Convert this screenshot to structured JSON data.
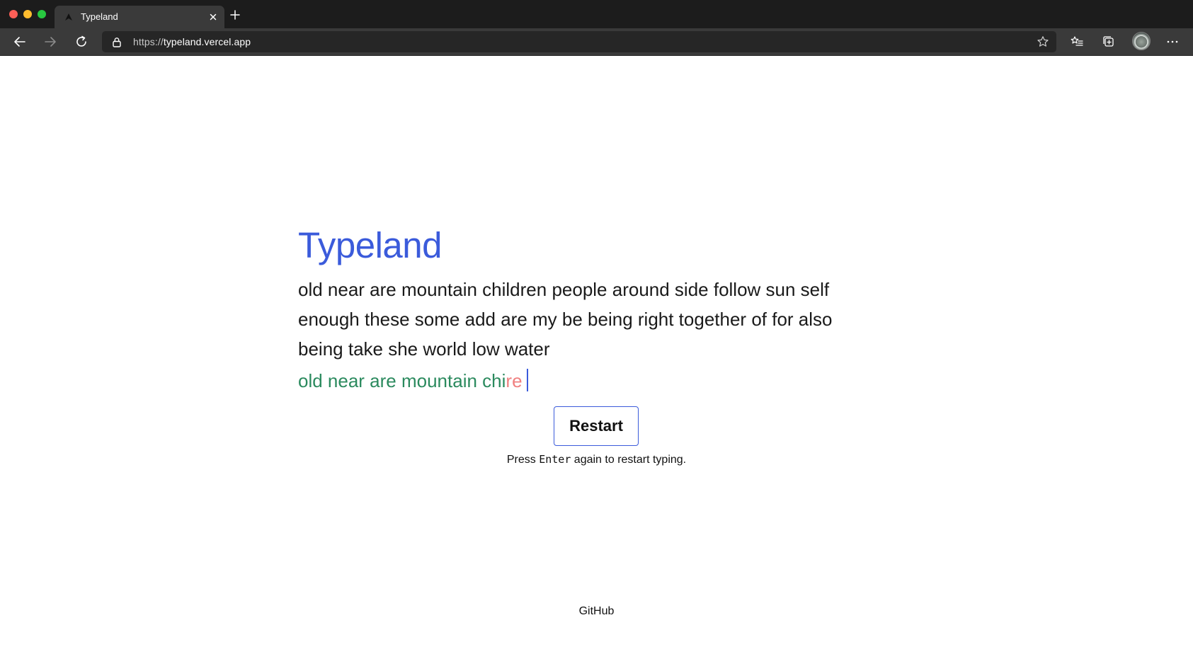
{
  "browser": {
    "tab_title": "Typeland",
    "url_scheme": "https://",
    "url_host": "typeland.vercel.app",
    "icons": {
      "back": "arrow-left-icon",
      "forward": "arrow-right-icon",
      "reload": "reload-icon",
      "lock": "lock-icon",
      "favorite": "star-icon",
      "favorites_list": "favorites-list-icon",
      "collections": "collections-icon",
      "profile": "avatar",
      "menu": "more-horizontal-icon",
      "close_tab": "close-icon",
      "new_tab": "plus-icon"
    }
  },
  "page": {
    "title": "Typeland",
    "prompt_text": "old near are mountain children people around side follow sun self enough these some add are my be being right together of for also being take she world low water",
    "typed_correct": "old near are mountain chi",
    "typed_incorrect": "re",
    "restart_label": "Restart",
    "hint_before": "Press ",
    "hint_key": "Enter",
    "hint_after": " again to restart typing.",
    "footer_link": "GitHub"
  },
  "colors": {
    "accent": "#3b5bdb",
    "correct": "#2b8a5e",
    "incorrect": "#f08080"
  }
}
